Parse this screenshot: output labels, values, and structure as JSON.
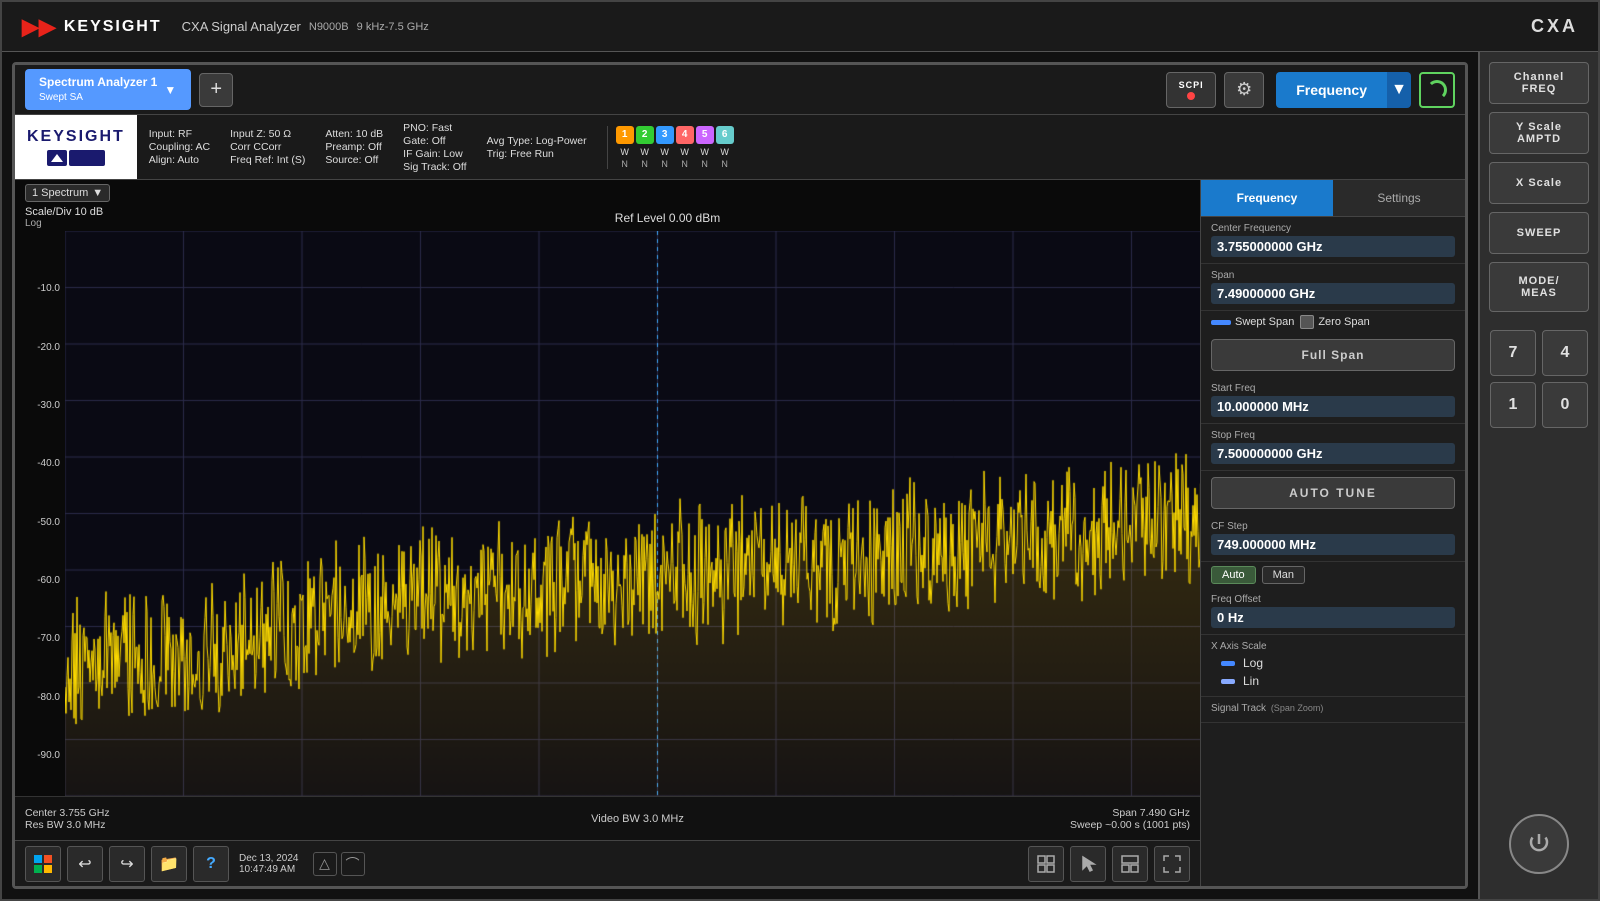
{
  "instrument": {
    "brand": "KEYSIGHT",
    "model": "CXA Signal Analyzer",
    "partNumber": "N9000B",
    "freqRange": "9 kHz-7.5 GHz",
    "modelShort": "CXA"
  },
  "tab": {
    "label": "Spectrum Analyzer 1\nSwept SA",
    "line1": "Spectrum Analyzer 1",
    "line2": "Swept SA"
  },
  "infoBar": {
    "inputType": "Input: RF",
    "coupling": "Coupling: AC",
    "align": "Align: Auto",
    "inputZ": "Input Z: 50 Ω",
    "corrCCorr": "Corr CCorr",
    "freqRef": "Freq Ref: Int (S)",
    "atten": "Atten: 10 dB",
    "preamp": "Preamp: Off",
    "source": "Source: Off",
    "pno": "PNO: Fast",
    "gate": "Gate: Off",
    "ifGain": "IF Gain: Low",
    "sigTrack": "Sig Track: Off",
    "avgType": "Avg Type: Log-Power",
    "trig": "Trig: Free Run"
  },
  "spectrum": {
    "traceLabel": "1 Spectrum",
    "scaleLabel": "Scale/Div 10 dB",
    "scaleType": "Log",
    "refLevel": "Ref Level 0.00 dBm",
    "yLabels": [
      "",
      "-10.0",
      "-20.0",
      "-30.0",
      "-40.0",
      "-50.0",
      "-60.0",
      "-70.0",
      "-80.0",
      "-90.0"
    ],
    "footer": {
      "center": "Center 3.755 GHz",
      "resBW": "Res BW 3.0 MHz",
      "videoBW": "Video BW 3.0 MHz",
      "span": "Span 7.490 GHz",
      "sweep": "Sweep ~0.00 s (1001 pts)"
    }
  },
  "freqPanel": {
    "activeTab": "Frequency",
    "inactiveTab": "Settings",
    "centerFreqLabel": "Center Frequency",
    "centerFreqValue": "3.755000000 GHz",
    "spanLabel": "Span",
    "spanValue": "7.49000000 GHz",
    "sweptSpanLabel": "Swept Span",
    "zeroSpanLabel": "Zero Span",
    "fullSpanLabel": "Full Span",
    "startFreqLabel": "Start Freq",
    "startFreqValue": "10.000000 MHz",
    "stopFreqLabel": "Stop Freq",
    "stopFreqValue": "7.500000000 GHz",
    "autoTuneLabel": "AUTO TUNE",
    "cfStepLabel": "CF Step",
    "cfStepValue": "749.000000 MHz",
    "autoLabel": "Auto",
    "manLabel": "Man",
    "freqOffsetLabel": "Freq Offset",
    "freqOffsetValue": "0 Hz",
    "xAxisScaleLabel": "X Axis Scale",
    "logLabel": "Log",
    "linLabel": "Lin",
    "signalTrackLabel": "Signal Track",
    "spanZoomLabel": "(Span Zoom)"
  },
  "taskbar": {
    "datetime": "Dec 13, 2024",
    "time": "10:47:49 AM"
  },
  "rightPanel": {
    "buttons": [
      "FREQ",
      "AMPTD",
      "Scale",
      "SWEEP",
      "MODE/\nMEAS"
    ],
    "numpad": [
      "7",
      "4",
      "1",
      "0"
    ]
  },
  "channelBar": {
    "numbers": [
      "1",
      "2",
      "3",
      "4",
      "5",
      "6"
    ],
    "wLetters": [
      "W",
      "W",
      "W",
      "W",
      "W",
      "W"
    ],
    "nLetters": [
      "N",
      "N",
      "N",
      "N",
      "N",
      "N"
    ]
  }
}
